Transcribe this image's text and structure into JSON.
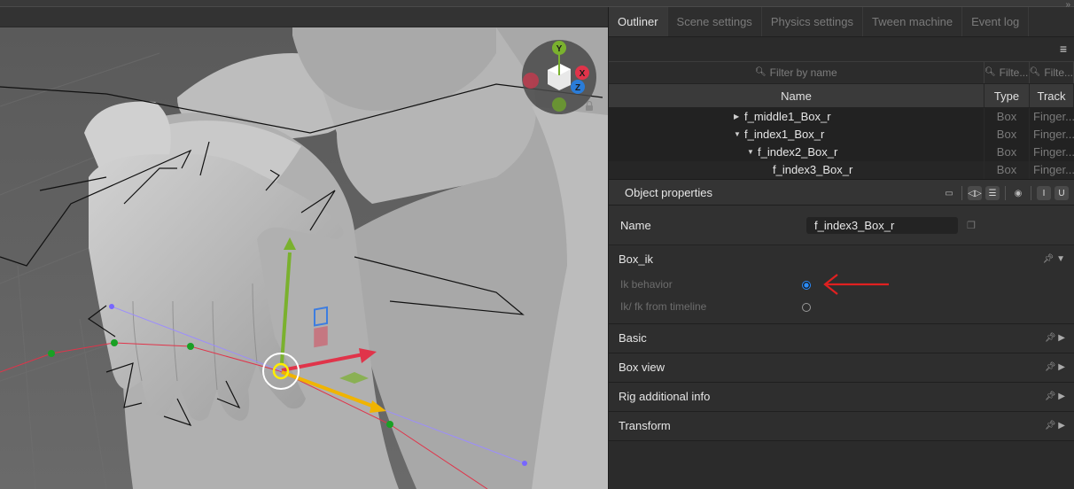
{
  "panel_tabs": [
    "Outliner",
    "Scene settings",
    "Physics settings",
    "Tween machine",
    "Event log"
  ],
  "outliner": {
    "menu_icon": "hamburger-icon",
    "filters": {
      "name_placeholder": "Filter by name",
      "type_placeholder": "Filte...",
      "track_placeholder": "Filte..."
    },
    "columns": [
      "Name",
      "Type",
      "Track"
    ],
    "rows": [
      {
        "name": "f_middle1_Box_r",
        "type": "Box",
        "track": "Finger...",
        "toggle": "collapsed"
      },
      {
        "name": "f_index1_Box_r",
        "type": "Box",
        "track": "Finger...",
        "toggle": "expanded"
      },
      {
        "name": "f_index2_Box_r",
        "type": "Box",
        "track": "Finger...",
        "toggle": "expanded"
      },
      {
        "name": "f_index3_Box_r",
        "type": "Box",
        "track": "Finger...",
        "toggle": "none"
      }
    ]
  },
  "object_properties": {
    "title": "Object properties",
    "name_label": "Name",
    "name_value": "f_index3_Box_r",
    "sections": {
      "box_ik": {
        "title": "Box_ik",
        "props": [
          {
            "label": "Ik behavior",
            "checked": true
          },
          {
            "label": "Ik/ fk  from  timeline",
            "checked": false
          }
        ]
      },
      "basic": {
        "title": "Basic"
      },
      "box_view": {
        "title": "Box view"
      },
      "rig_info": {
        "title": "Rig additional info"
      },
      "transform": {
        "title": "Transform"
      }
    }
  },
  "gizmo": {
    "y": "Y",
    "x": "X",
    "z": "Z"
  },
  "colors": {
    "accent": "#2a8cff",
    "annotation_arrow": "#e02020",
    "x_axis": "#e0344a",
    "y_axis": "#7ab12e",
    "z_axis": "#2a7cd8"
  }
}
